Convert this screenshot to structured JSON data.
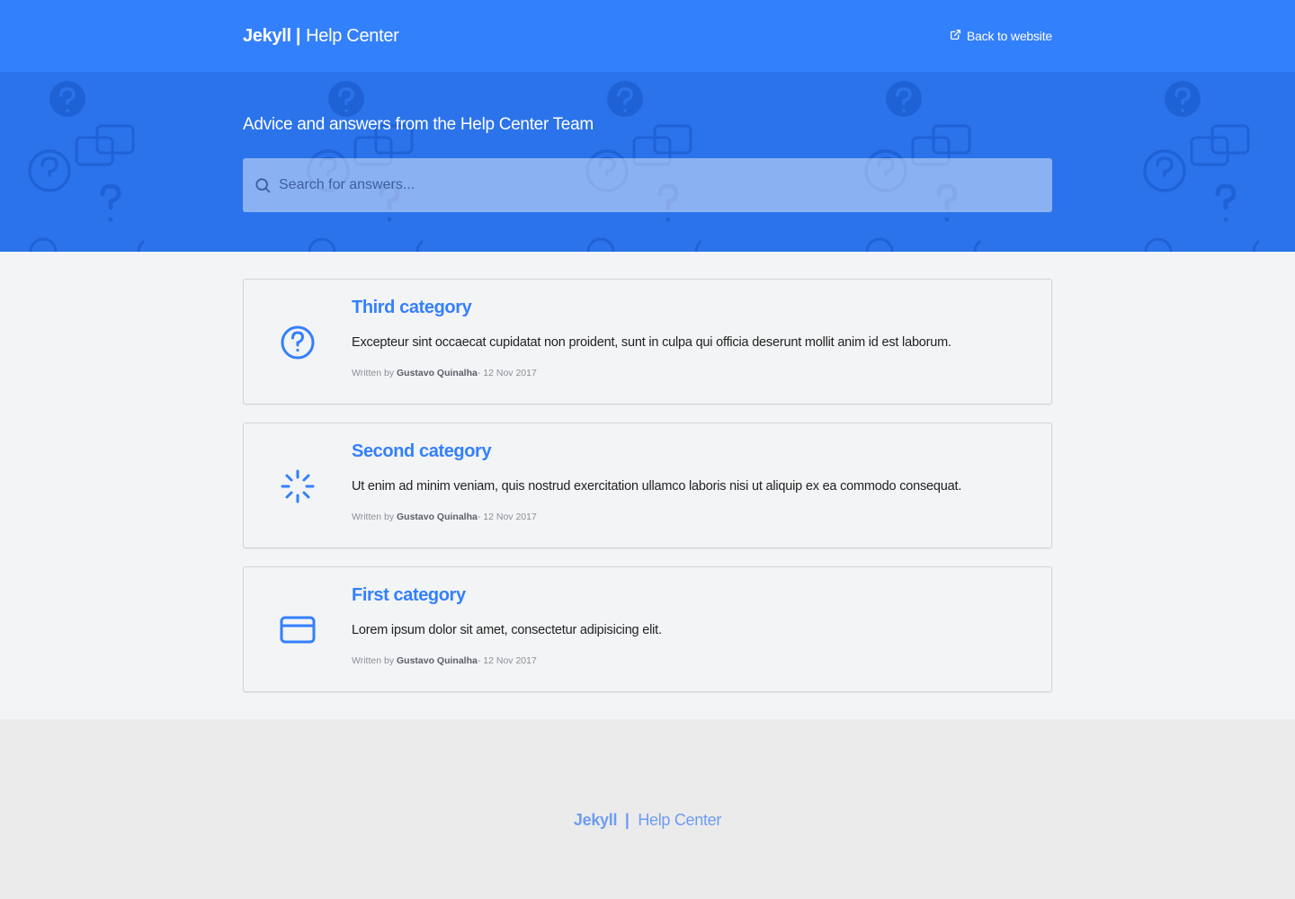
{
  "header": {
    "brand_strong": "Jekyll",
    "brand_sep": "|",
    "brand_rest": "Help Center",
    "back_label": "Back to website",
    "back_icon": "external-link-icon"
  },
  "hero": {
    "tagline": "Advice and answers from the Help Center Team",
    "search_placeholder": "Search for answers..."
  },
  "categories": [
    {
      "title": "Third category",
      "description": "Excepteur sint occaecat cupidatat non proident, sunt in culpa qui officia deserunt mollit anim id est laborum.",
      "written_by": "Written by",
      "author": "Gustavo Quinalha",
      "date_prefix": "- ",
      "date": "12 Nov 2017",
      "icon": "help-circle-icon"
    },
    {
      "title": "Second category",
      "description": "Ut enim ad minim veniam, quis nostrud exercitation ullamco laboris nisi ut aliquip ex ea commodo consequat.",
      "written_by": "Written by",
      "author": "Gustavo Quinalha",
      "date_prefix": "- ",
      "date": "12 Nov 2017",
      "icon": "loader-icon"
    },
    {
      "title": "First category",
      "description": "Lorem ipsum dolor sit amet, consectetur adipisicing elit.",
      "written_by": "Written by",
      "author": "Gustavo Quinalha",
      "date_prefix": "- ",
      "date": "12 Nov 2017",
      "icon": "credit-card-icon"
    }
  ],
  "footer": {
    "brand_strong": "Jekyll",
    "brand_sep": "|",
    "brand_rest": "Help Center"
  },
  "colors": {
    "primary": "#3380fc",
    "hero_bg": "#2b73ea",
    "page_bg": "#f3f4f6",
    "footer_bg": "#ebebeb"
  }
}
